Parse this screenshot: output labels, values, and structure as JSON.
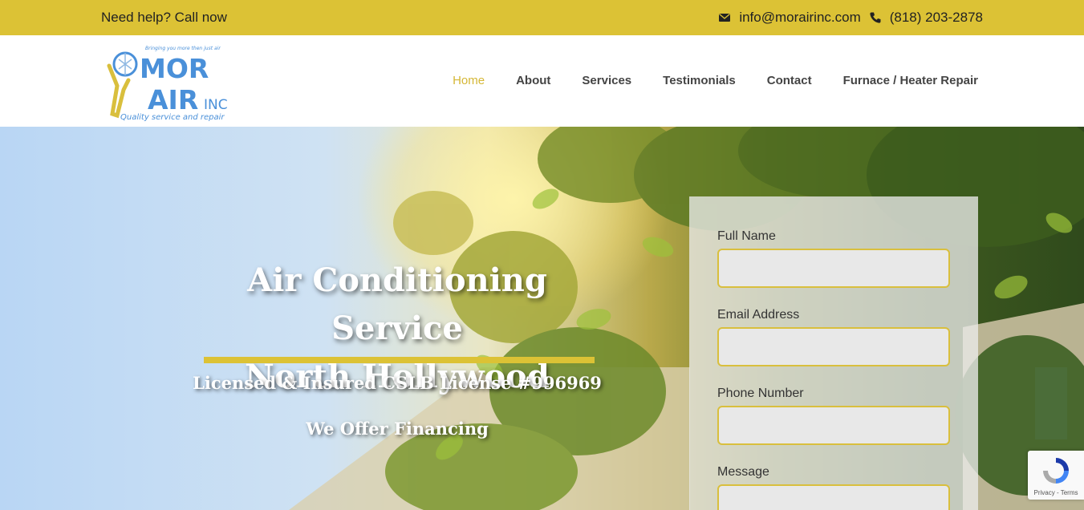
{
  "topbar": {
    "help_text": "Need help? Call now",
    "email": "info@morairinc.com",
    "phone": "(818) 203-2878",
    "icons": [
      "envelope-icon",
      "phone-icon"
    ]
  },
  "logo": {
    "tagline": "Bringing you more then just air",
    "name_line1": "MOR",
    "name_line2": "AIR",
    "suffix": "INC",
    "slogan": "Quality service and repair"
  },
  "nav": {
    "items": [
      {
        "label": "Home",
        "active": true
      },
      {
        "label": "About",
        "active": false
      },
      {
        "label": "Services",
        "active": false
      },
      {
        "label": "Testimonials",
        "active": false
      },
      {
        "label": "Contact",
        "active": false
      },
      {
        "label": "Furnace / Heater Repair",
        "active": false
      }
    ]
  },
  "hero": {
    "title_line1": "Air Conditioning Service",
    "title_line2": "North Hollywood",
    "license": "Licensed & Insured CSLB License #996969",
    "financing": "We Offer Financing"
  },
  "form": {
    "full_name_label": "Full Name",
    "email_label": "Email Address",
    "phone_label": "Phone Number",
    "message_label": "Message"
  },
  "recaptcha": {
    "terms": "Privacy - Terms"
  },
  "colors": {
    "accent": "#dcc235",
    "nav_active": "#d5b736",
    "logo_blue": "#4a90d9"
  }
}
